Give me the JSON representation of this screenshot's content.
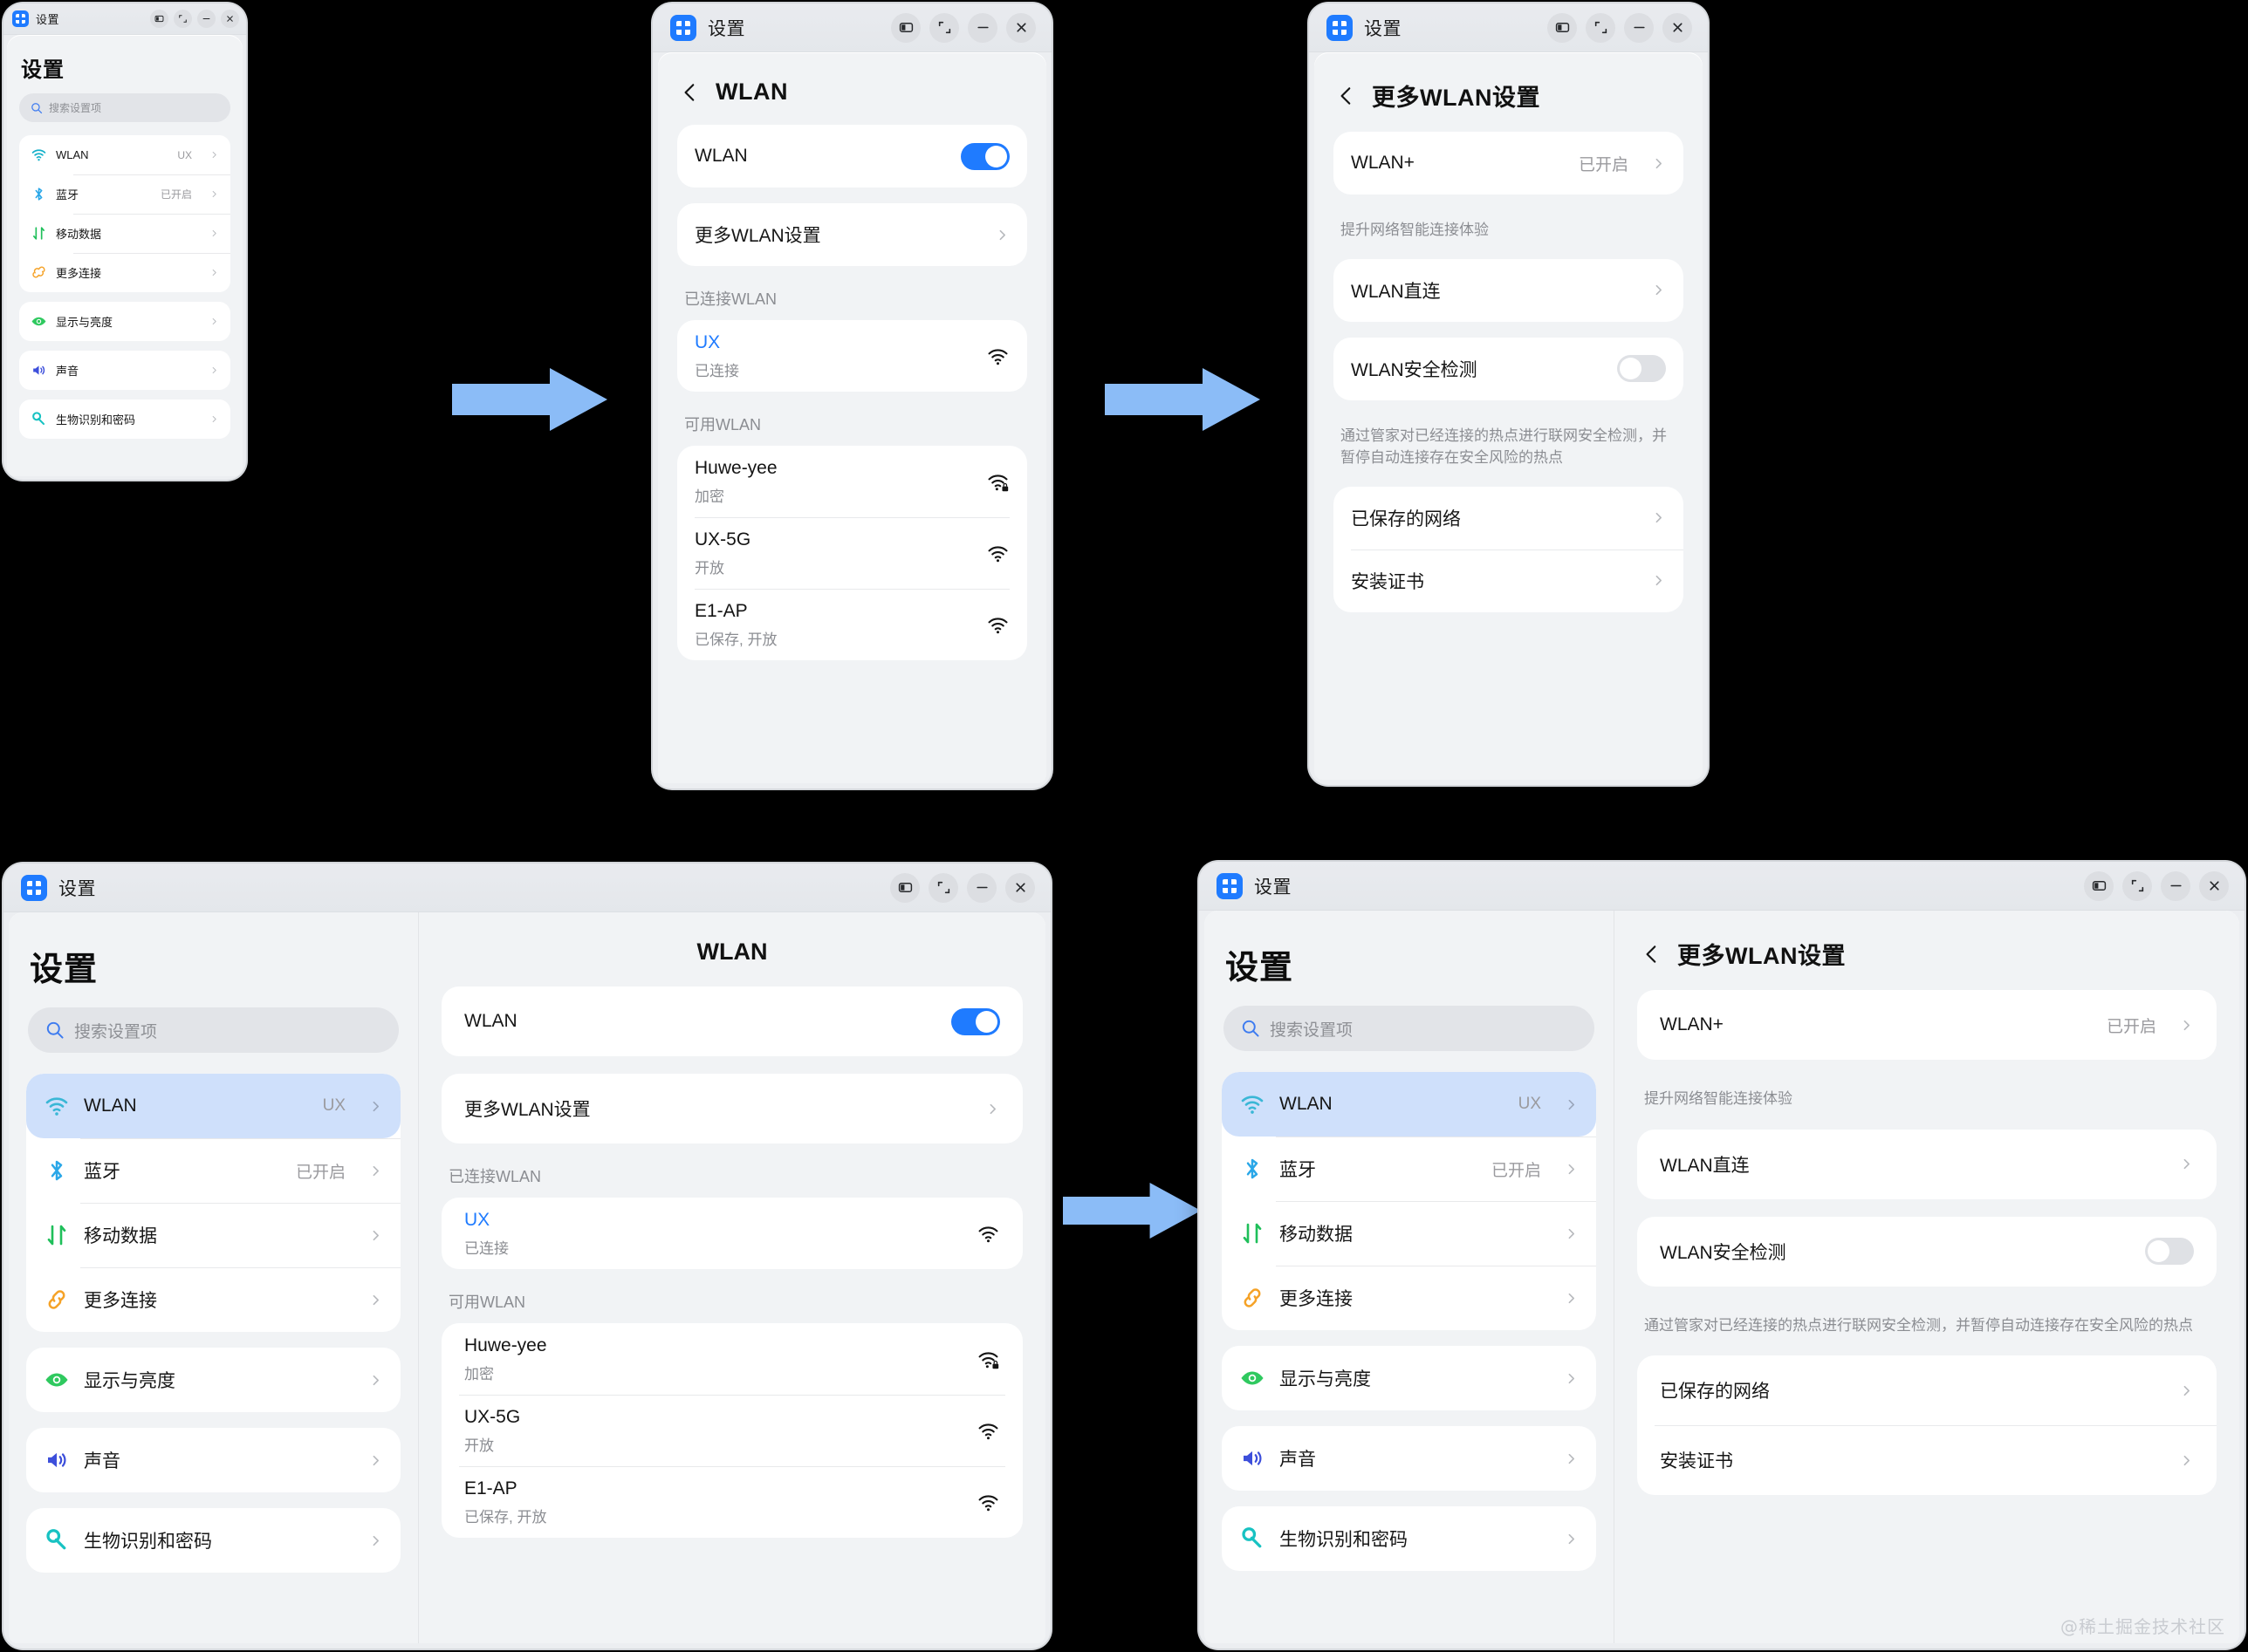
{
  "window": {
    "app_title": "设置",
    "buttons": {
      "split_label": "split-view",
      "restore_label": "restore",
      "minimize_label": "minimize",
      "close_label": "close"
    }
  },
  "settings_home": {
    "page_title": "设置",
    "search_placeholder": "搜索设置项",
    "groups": [
      {
        "items": [
          {
            "icon": "wifi-icon",
            "label": "WLAN",
            "value": "UX",
            "chevron": true,
            "selected": true
          },
          {
            "icon": "bluetooth-icon",
            "label": "蓝牙",
            "value": "已开启",
            "chevron": true
          },
          {
            "icon": "mobiledata-icon",
            "label": "移动数据",
            "value": "",
            "chevron": true
          },
          {
            "icon": "link-icon",
            "label": "更多连接",
            "value": "",
            "chevron": true
          }
        ]
      },
      {
        "items": [
          {
            "icon": "eye-icon",
            "label": "显示与亮度",
            "value": "",
            "chevron": true
          }
        ]
      },
      {
        "items": [
          {
            "icon": "sound-icon",
            "label": "声音",
            "value": "",
            "chevron": true
          }
        ]
      },
      {
        "items": [
          {
            "icon": "key-icon",
            "label": "生物识别和密码",
            "value": "",
            "chevron": true
          }
        ]
      }
    ]
  },
  "wlan_page": {
    "title": "WLAN",
    "back_label": "返回",
    "toggle_row_label": "WLAN",
    "toggle_state": "on",
    "more_settings_label": "更多WLAN设置",
    "connected_group_label": "已连接WLAN",
    "connected": {
      "name": "UX",
      "status": "已连接",
      "signal": "wifi-full-icon"
    },
    "available_group_label": "可用WLAN",
    "available": [
      {
        "name": "Huwe-yee",
        "status": "加密",
        "signal": "wifi-lock-icon"
      },
      {
        "name": "UX-5G",
        "status": "开放",
        "signal": "wifi-full-icon"
      },
      {
        "name": "E1-AP",
        "status": "已保存, 开放",
        "signal": "wifi-full-icon"
      }
    ]
  },
  "more_wlan_page": {
    "title": "更多WLAN设置",
    "back_label": "返回",
    "wlan_plus": {
      "label": "WLAN+",
      "value": "已开启",
      "hint": "提升网络智能连接体验"
    },
    "wlan_direct": {
      "label": "WLAN直连"
    },
    "wlan_security": {
      "label": "WLAN安全检测",
      "toggle_state": "off",
      "hint": "通过管家对已经连接的热点进行联网安全检测，并暂停自动连接存在安全风险的热点"
    },
    "saved_networks": {
      "label": "已保存的网络"
    },
    "install_cert": {
      "label": "安装证书"
    }
  },
  "flow": {
    "arrow_color": "#8bbcf7",
    "arrow_label": "flow-arrow"
  },
  "watermark": "@稀土掘金技术社区"
}
